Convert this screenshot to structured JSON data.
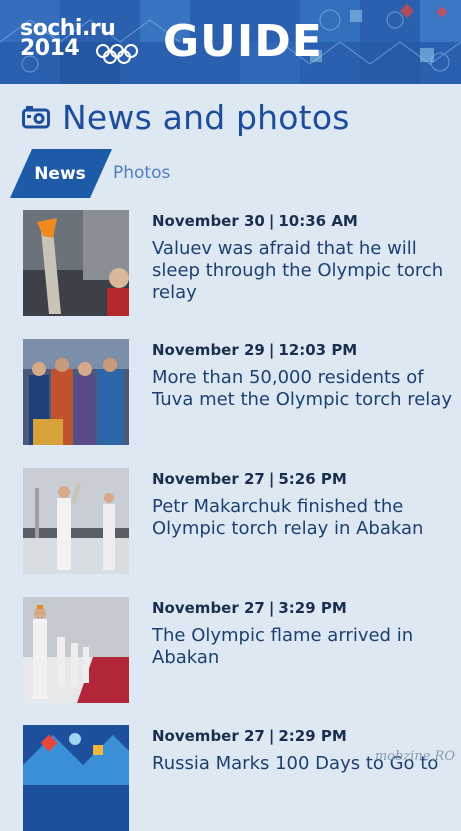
{
  "header": {
    "brand_line1": "sochi.ru",
    "brand_line2": "2014",
    "guide": "GUIDE"
  },
  "section": {
    "title": "News and photos",
    "icon": "camera-icon"
  },
  "tabs": [
    {
      "label": "News",
      "active": true
    },
    {
      "label": "Photos",
      "active": false
    }
  ],
  "news": [
    {
      "date": "November 30",
      "time": "10:36 AM",
      "headline": "Valuev was afraid that he will sleep through the Olympic torch relay"
    },
    {
      "date": "November 29",
      "time": "12:03 PM",
      "headline": "More than 50,000 residents of Tuva met the Olympic torch relay"
    },
    {
      "date": "November 27",
      "time": "5:26 PM",
      "headline": "Petr Makarchuk finished the Olympic torch relay in Abakan"
    },
    {
      "date": "November 27",
      "time": "3:29 PM",
      "headline": "The Olympic flame arrived in Abakan"
    },
    {
      "date": "November 27",
      "time": "2:29 PM",
      "headline": "Russia Marks 100 Days to Go to"
    }
  ],
  "watermark": "mobzine.RO",
  "colors": {
    "accent": "#1d5aa8",
    "background": "#dde8f2",
    "banner": "#2a63b3"
  }
}
